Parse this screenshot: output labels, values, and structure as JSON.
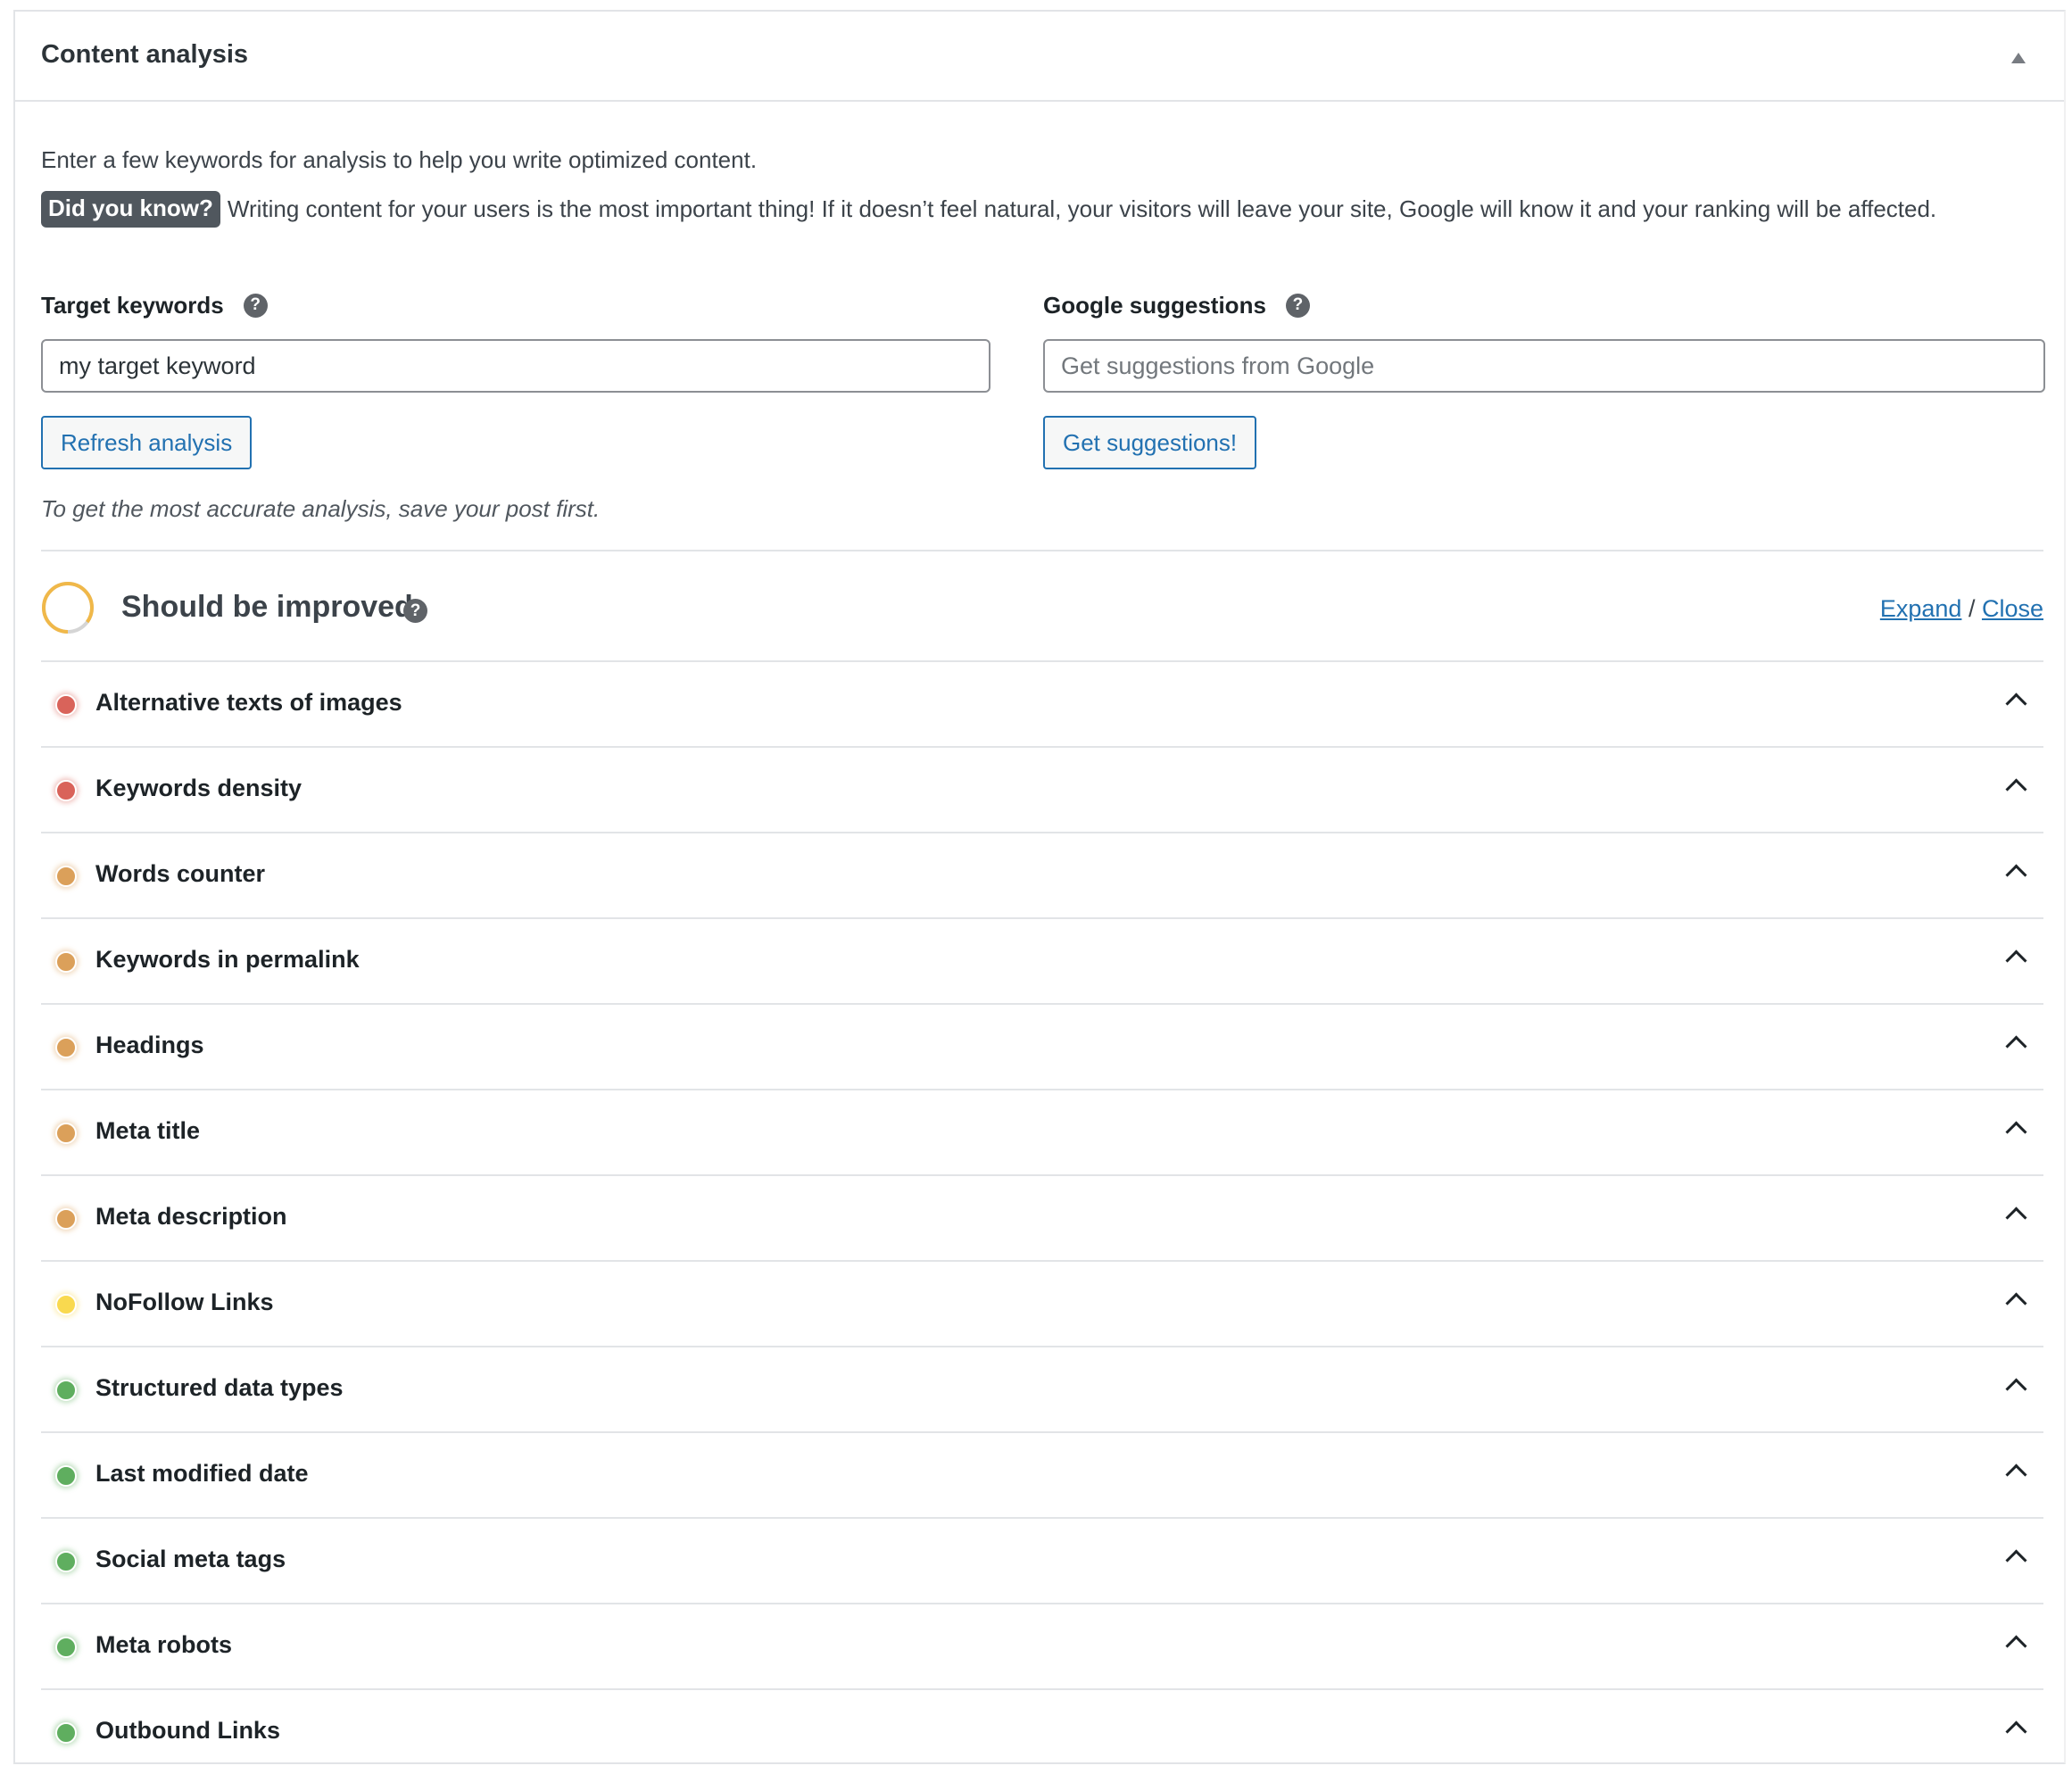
{
  "panel": {
    "title": "Content analysis",
    "toggle_icon": "triangle-up-icon"
  },
  "intro_text": "Enter a few keywords for analysis to help you write optimized content.",
  "tip": {
    "badge": "Did you know?",
    "text": "Writing content for your users is the most important thing! If it doesn’t feel natural, your visitors will leave your site, Google will know it and your ranking will be affected."
  },
  "target_keywords": {
    "label": "Target keywords",
    "help_icon": "?",
    "value": "my target keyword",
    "placeholder": "",
    "button": "Refresh analysis"
  },
  "google_suggestions": {
    "label": "Google suggestions",
    "help_icon": "?",
    "value": "",
    "placeholder": "Get suggestions from Google",
    "button": "Get suggestions!"
  },
  "note": "To get the most accurate analysis, save your post first.",
  "summary": {
    "title": "Should be improved",
    "help_icon": "?",
    "score_fraction": 0.85,
    "ring_color": "#f0b849",
    "ring_track_color": "#d5d5d5",
    "expand_label": "Expand",
    "separator": "/",
    "close_label": "Close"
  },
  "status_colors": {
    "error": "#d9635a",
    "warning": "#dba05a",
    "notice": "#f9d94f",
    "good": "#5fae5f"
  },
  "checks": [
    {
      "label": "Alternative texts of images",
      "status": "error"
    },
    {
      "label": "Keywords density",
      "status": "error"
    },
    {
      "label": "Words counter",
      "status": "warning"
    },
    {
      "label": "Keywords in permalink",
      "status": "warning"
    },
    {
      "label": "Headings",
      "status": "warning"
    },
    {
      "label": "Meta title",
      "status": "warning"
    },
    {
      "label": "Meta description",
      "status": "warning"
    },
    {
      "label": "NoFollow Links",
      "status": "notice"
    },
    {
      "label": "Structured data types",
      "status": "good"
    },
    {
      "label": "Last modified date",
      "status": "good"
    },
    {
      "label": "Social meta tags",
      "status": "good"
    },
    {
      "label": "Meta robots",
      "status": "good"
    },
    {
      "label": "Outbound Links",
      "status": "good"
    }
  ]
}
